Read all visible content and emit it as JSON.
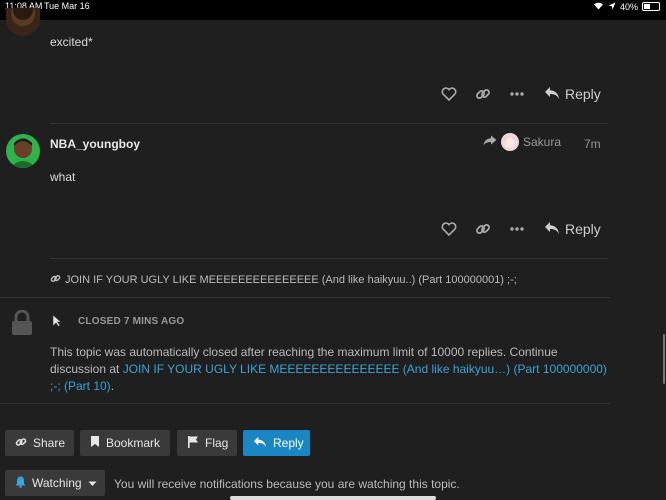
{
  "status_bar": {
    "time": "11:08 AM",
    "date": "Tue Mar 16",
    "battery": "40%",
    "battery_level": 0.4
  },
  "posts": [
    {
      "text": "excited*",
      "reply_label": "Reply"
    },
    {
      "username": "NBA_youngboy",
      "reply_to": "Sakura",
      "age": "7m",
      "text": "what",
      "reply_label": "Reply"
    }
  ],
  "linked_topic": "JOIN IF YOUR UGLY LIKE MEEEEEEEEEEEEEEE (And like haikyuu..) (Part 100000001) ;-;",
  "closed_notice": {
    "label": "CLOSED 7 MINS AGO",
    "text_before": "This topic was automatically closed after reaching the maximum limit of 10000 replies. Continue discussion at ",
    "link_text": "JOIN IF YOUR UGLY LIKE MEEEEEEEEEEEEEEE (And like haikyuu…) (Part 100000000) ;-; (Part 10)",
    "text_after": "."
  },
  "footer_buttons": {
    "share": "Share",
    "bookmark": "Bookmark",
    "flag": "Flag",
    "reply": "Reply"
  },
  "notifications": {
    "level": "Watching",
    "message": "You will receive notifications because you are watching this topic."
  },
  "colors": {
    "background": "#1f1f1f",
    "link": "#3ea3d8",
    "primary_button": "#1a87c4"
  }
}
